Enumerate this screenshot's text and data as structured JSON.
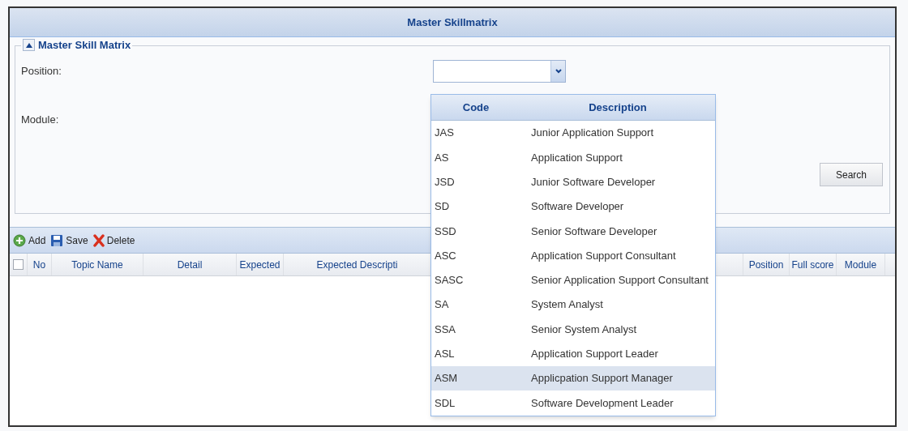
{
  "window": {
    "title": "Master Skillmatrix"
  },
  "panel": {
    "legend": "Master Skill Matrix",
    "expanded": true
  },
  "form": {
    "position_label": "Position:",
    "module_label": "Module:",
    "search_button": "Search"
  },
  "toolbar": [
    {
      "kind": "add",
      "label": "Add"
    },
    {
      "kind": "save",
      "label": "Save"
    },
    {
      "kind": "delete",
      "label": "Delete"
    }
  ],
  "grid": {
    "select_all_checked": false,
    "columns": [
      "No",
      "Topic Name",
      "Detail",
      "Expected",
      "Expected Descripti",
      "Position",
      "Full score",
      "Module"
    ]
  },
  "dropdown": {
    "columns": [
      "Code",
      "Description"
    ],
    "rows": [
      {
        "code": "JAS",
        "description": "Junior Application Support",
        "selected": false
      },
      {
        "code": "AS",
        "description": "Application Support",
        "selected": false
      },
      {
        "code": "JSD",
        "description": "Junior Software Developer",
        "selected": false
      },
      {
        "code": "SD",
        "description": "Software Developer",
        "selected": false
      },
      {
        "code": "SSD",
        "description": "Senior Software Developer",
        "selected": false
      },
      {
        "code": "ASC",
        "description": "Application Support Consultant",
        "selected": false
      },
      {
        "code": "SASC",
        "description": "Senior Application Support Consultant",
        "selected": false
      },
      {
        "code": "SA",
        "description": "System Analyst",
        "selected": false
      },
      {
        "code": "SSA",
        "description": "Senior System Analyst",
        "selected": false
      },
      {
        "code": "ASL",
        "description": "Application Support Leader",
        "selected": false
      },
      {
        "code": "ASM",
        "description": "Applicpation Support Manager",
        "selected": true
      },
      {
        "code": "SDL",
        "description": "Software Development Leader",
        "selected": false
      }
    ]
  }
}
